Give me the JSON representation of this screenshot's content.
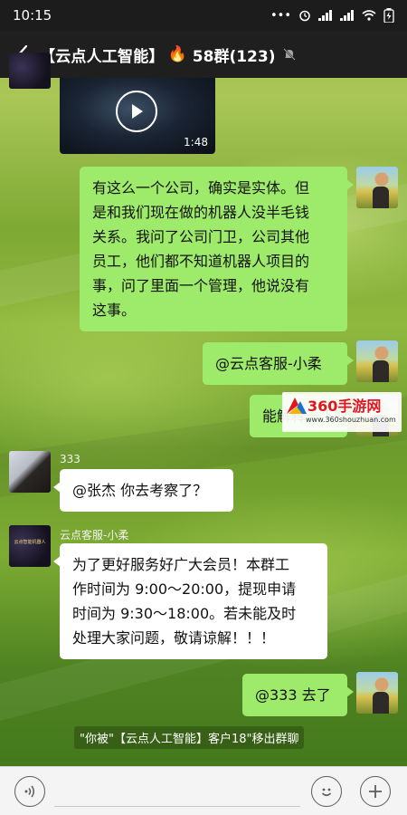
{
  "status_bar": {
    "time": "10:15",
    "icons": [
      "dots-icon",
      "alarm-icon",
      "signal-icon",
      "signal-icon",
      "wifi-icon",
      "battery-icon"
    ]
  },
  "header": {
    "title": "【云点人工智能】",
    "fire": "🔥",
    "member_count": "58群(123)"
  },
  "video": {
    "duration": "1:48"
  },
  "messages": [
    {
      "side": "self",
      "text": "有这么一个公司，确实是实体。但是和我们现在做的机器人没半毛钱关系。我问了公司门卫，公司其他员工，他们都不知道机器人项目的事，问了里面一个管理，他说没有这事。"
    },
    {
      "side": "self",
      "text": "@云点客服-小柔"
    },
    {
      "side": "self",
      "text": "能解释一下吗"
    },
    {
      "side": "other",
      "sender": "333",
      "text": "@张杰  你去考察了？"
    },
    {
      "side": "other",
      "sender": "云点客服-小柔",
      "text": "为了更好服务好广大会员！本群工作时间为 9:00～20:00，提现申请时间为 9:30～18:00。若未能及时处理大家问题，敬请谅解！！！"
    },
    {
      "side": "self",
      "text": "@333  去了"
    }
  ],
  "bubble_lines": {
    "m0": [
      "有这么一个公司，确实是实体。但",
      "是和我们现在做的机器人没半毛钱",
      "关系。我问了公司门卫，公司其他",
      "员工，他们都不知道机器人项目的",
      "事，问了里面一个管理，他说没有",
      "这事。"
    ],
    "m4": [
      "为了更好服务好广大会员！本群工",
      "作时间为 9:00～20:00，提现申请",
      "时间为 9:30～18:00。若未能及时",
      "处理大家问题，敬请谅解！！！"
    ]
  },
  "system_message": "\"你被\"【云点人工智能】客户18\"移出群聊",
  "watermark": {
    "name": "360手游网",
    "url": "www.360shouzhuan.com"
  },
  "avatar_labels": {
    "kefu": "云点智能机器人"
  },
  "input": {
    "placeholder": ""
  },
  "colors": {
    "self_bubble": "#9eea6a",
    "other_bubble": "#ffffff",
    "title_bar": "#1f1f1f"
  }
}
